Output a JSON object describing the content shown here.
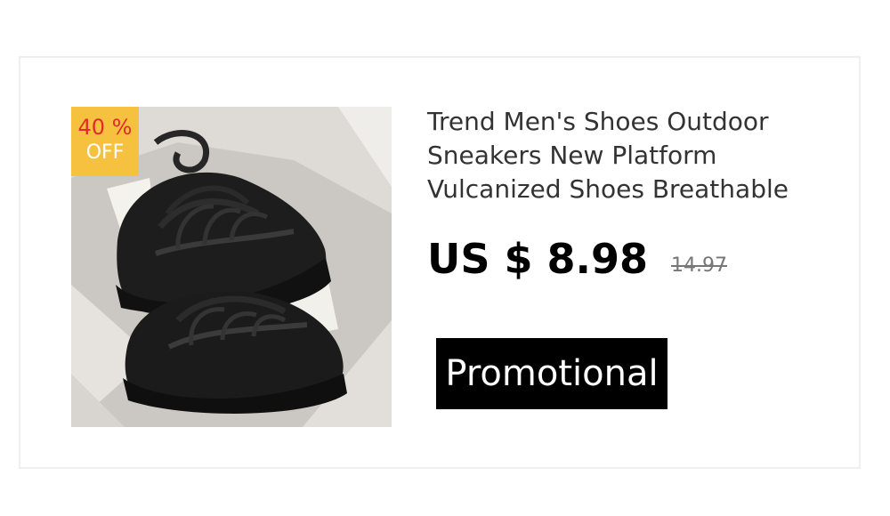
{
  "product": {
    "title": "Trend Men's Shoes Outdoor Sneakers New Platform Vulcanized Shoes Breathable",
    "price_current": "US $ 8.98",
    "price_original": "14.97",
    "discount": {
      "percent_label": "40 %",
      "off_label": "OFF"
    },
    "image_icon": "sneaker-photo",
    "promo_button_label": "Promotional"
  },
  "colors": {
    "badge_background": "#f7c140",
    "badge_percent_text": "#e12b2b",
    "button_background": "#000000",
    "original_price_text": "#777777"
  }
}
